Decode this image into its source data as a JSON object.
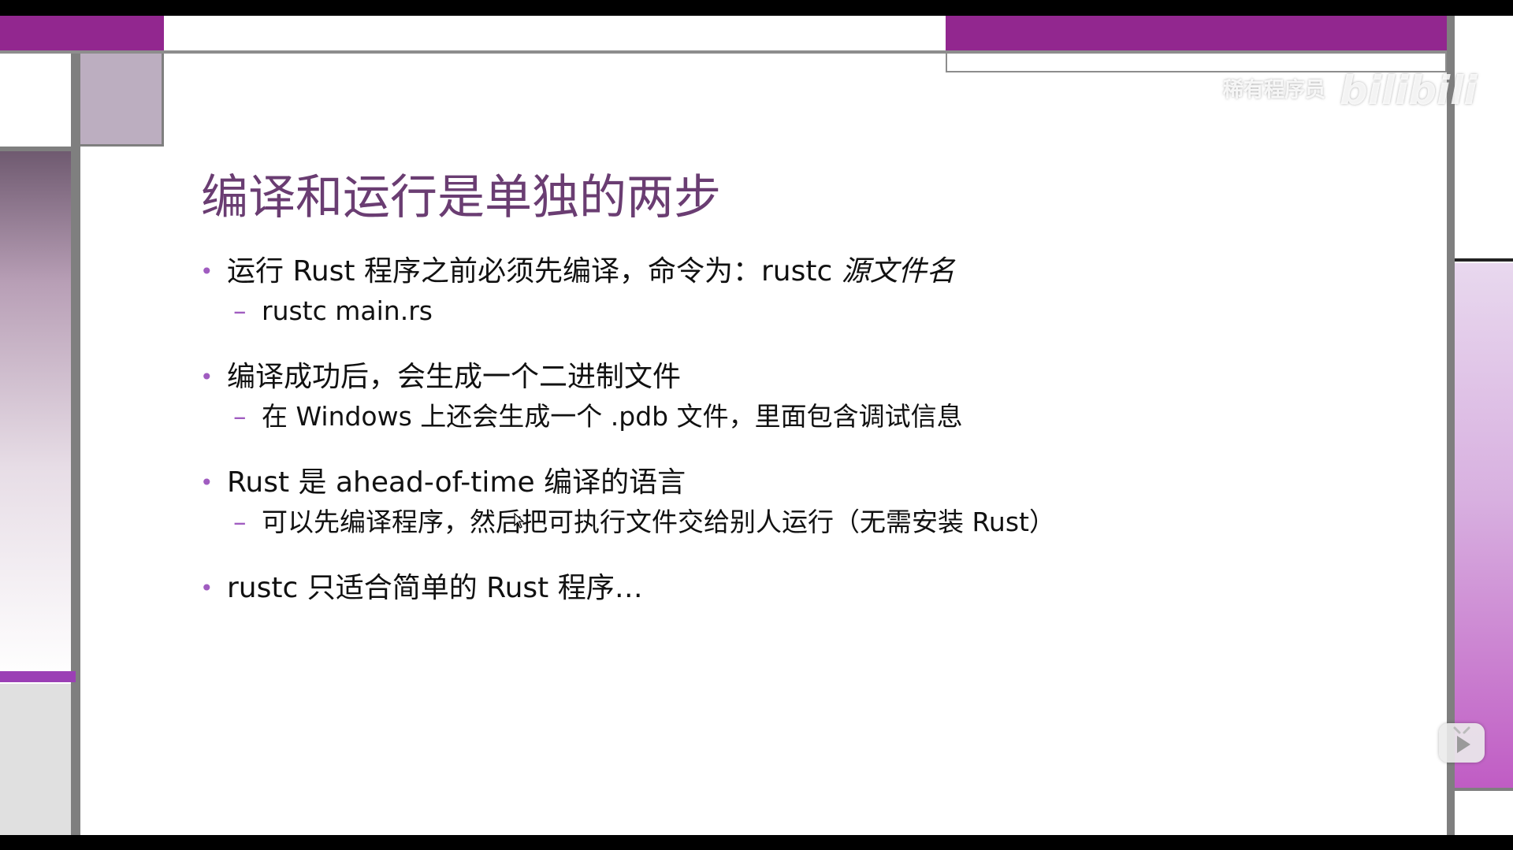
{
  "watermark": {
    "text": "稀有程序员",
    "logo": "bilibili"
  },
  "slide": {
    "title": "编译和运行是单独的两步",
    "bullets": [
      {
        "parts": [
          "运行 Rust 程序之前必须先编译，命令为：rustc ",
          "源文件名"
        ],
        "sub": "rustc main.rs"
      },
      {
        "parts": [
          "编译成功后，会生成一个二进制文件",
          ""
        ],
        "sub": "在 Windows 上还会生成一个 .pdb 文件，里面包含调试信息"
      },
      {
        "parts": [
          "Rust 是 ahead-of-time 编译的语言",
          ""
        ],
        "sub": "可以先编译程序，然后把可执行文件交给别人运行（无需安装 Rust）"
      },
      {
        "parts": [
          "rustc 只适合简单的 Rust 程序…",
          ""
        ],
        "sub": ""
      }
    ]
  },
  "icons": {
    "bullet": "•",
    "dash": "–",
    "play": "play-icon",
    "cursor": "mouse-cursor-icon"
  },
  "colors": {
    "accent_purple": "#92278f",
    "title_color": "#6a3d72",
    "bullet_color": "#a05cc0",
    "frame_gray": "#7f7f7f"
  }
}
